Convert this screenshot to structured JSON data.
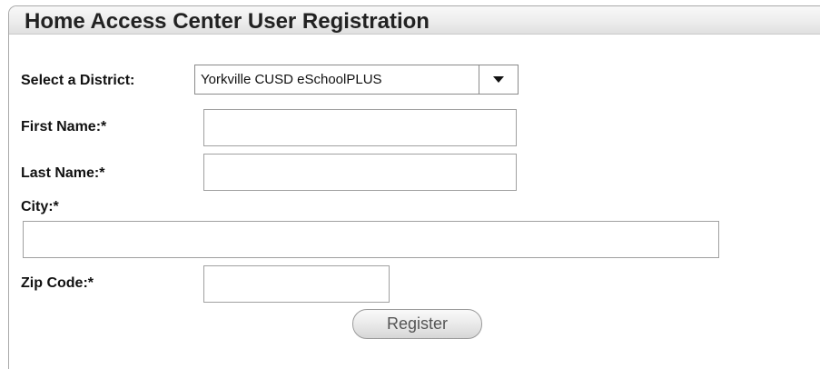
{
  "header": {
    "title": "Home Access Center User Registration"
  },
  "form": {
    "district": {
      "label": "Select a District:",
      "selected": "Yorkville CUSD eSchoolPLUS"
    },
    "first_name": {
      "label": "First Name:*",
      "value": ""
    },
    "last_name": {
      "label": "Last Name:*",
      "value": ""
    },
    "city": {
      "label": "City:*",
      "value": ""
    },
    "zip_code": {
      "label": "Zip Code:*",
      "value": ""
    },
    "register_label": "Register"
  },
  "icons": {
    "dropdown": "chevron-down-icon"
  }
}
